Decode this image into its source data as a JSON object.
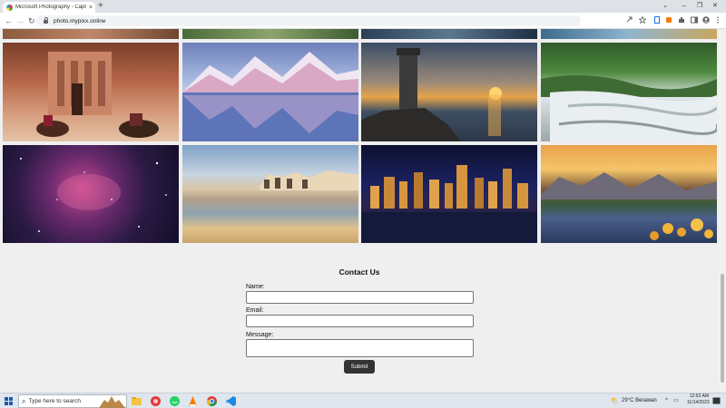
{
  "browser": {
    "tab_title": "Microsoft Photography - Captur",
    "tab_close": "×",
    "new_tab": "+",
    "url": "photo.mypixx.online",
    "window_controls": [
      "⌄",
      "–",
      "❐",
      "✕"
    ]
  },
  "gallery": {
    "images": [
      {
        "name": "petra-camels"
      },
      {
        "name": "snow-mountains-lake"
      },
      {
        "name": "lighthouse-sunset"
      },
      {
        "name": "waterfall-forest"
      },
      {
        "name": "nebula-space"
      },
      {
        "name": "desert-coast"
      },
      {
        "name": "city-skyline-night"
      },
      {
        "name": "mountain-lake-flowers"
      }
    ]
  },
  "contact": {
    "title": "Contact Us",
    "name_label": "Name:",
    "email_label": "Email:",
    "message_label": "Message:",
    "submit_label": "Submit"
  },
  "taskbar": {
    "search_placeholder": "Type here to search",
    "weather": "29°C  Berawan",
    "time": "12:52 AM",
    "date": "11/14/2023"
  },
  "colors": {
    "page_bg": "#efefef",
    "submit_bg": "#333333",
    "tabstrip_bg": "#dee1e6"
  }
}
